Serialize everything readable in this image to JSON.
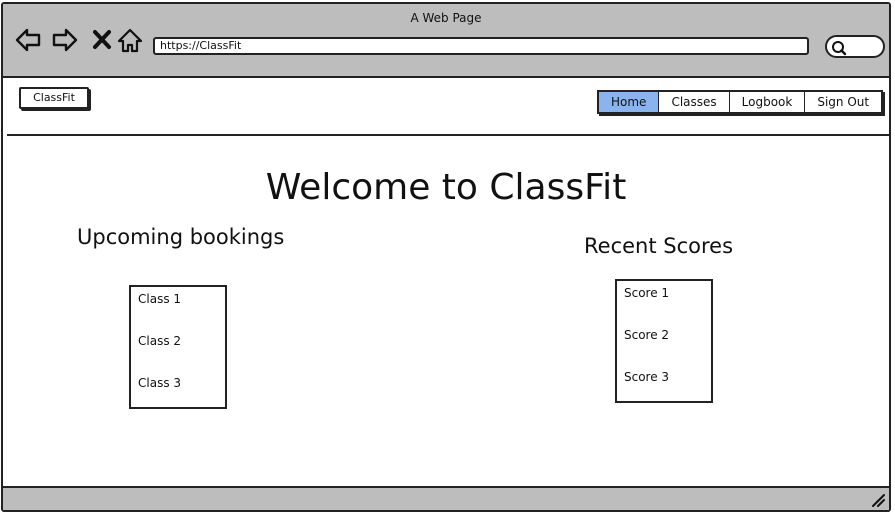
{
  "window": {
    "title": "A Web Page"
  },
  "browser": {
    "url": "https://ClassFit",
    "icons": [
      "back-icon",
      "forward-icon",
      "close-icon",
      "home-icon",
      "search-icon"
    ]
  },
  "header": {
    "logo": "ClassFit",
    "nav": [
      {
        "label": "Home",
        "active": true
      },
      {
        "label": "Classes",
        "active": false
      },
      {
        "label": "Logbook",
        "active": false
      },
      {
        "label": "Sign Out",
        "active": false
      }
    ],
    "active_color": "#8ab4f0"
  },
  "main": {
    "title": "Welcome to ClassFit",
    "bookings": {
      "heading": "Upcoming bookings",
      "items": [
        "Class 1",
        "Class 2",
        "Class 3"
      ]
    },
    "scores": {
      "heading": "Recent Scores",
      "items": [
        "Score 1",
        "Score 2",
        "Score 3"
      ]
    }
  },
  "colors": {
    "chrome": "#bdbdbd",
    "border": "#222222"
  }
}
